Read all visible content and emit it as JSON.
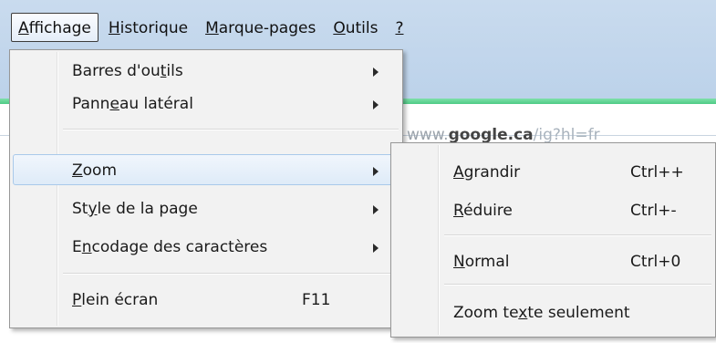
{
  "menubar": {
    "items": [
      {
        "pre": "",
        "u": "A",
        "post": "ffichage"
      },
      {
        "pre": "",
        "u": "H",
        "post": "istorique"
      },
      {
        "pre": "",
        "u": "M",
        "post": "arque-pages"
      },
      {
        "pre": "",
        "u": "O",
        "post": "utils"
      },
      {
        "pre": "",
        "u": "?",
        "post": ""
      }
    ]
  },
  "urlbar": {
    "prefix": "www.",
    "domain": "google.ca",
    "path": "/ig?hl=fr"
  },
  "view_menu": {
    "items": [
      {
        "pre": "Barres d'ou",
        "u": "t",
        "post": "ils",
        "shortcut": ""
      },
      {
        "pre": "Pann",
        "u": "e",
        "post": "au latéral",
        "shortcut": ""
      },
      {
        "pre": "",
        "u": "Z",
        "post": "oom",
        "shortcut": ""
      },
      {
        "pre": "St",
        "u": "y",
        "post": "le de la page",
        "shortcut": ""
      },
      {
        "pre": "E",
        "u": "n",
        "post": "codage des caractères",
        "shortcut": ""
      },
      {
        "pre": "",
        "u": "P",
        "post": "lein écran",
        "shortcut": "F11"
      }
    ]
  },
  "zoom_menu": {
    "items": [
      {
        "pre": "",
        "u": "A",
        "post": "grandir",
        "shortcut": "Ctrl++"
      },
      {
        "pre": "",
        "u": "R",
        "post": "éduire",
        "shortcut": "Ctrl+-"
      },
      {
        "pre": "",
        "u": "N",
        "post": "ormal",
        "shortcut": "Ctrl+0"
      },
      {
        "pre": "Zoom te",
        "u": "x",
        "post": "te seulement",
        "shortcut": ""
      }
    ]
  }
}
